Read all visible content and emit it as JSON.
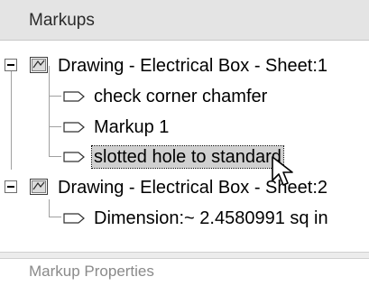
{
  "panel": {
    "title": "Markups",
    "footer_title": "Markup Properties"
  },
  "tree": {
    "sheets": [
      {
        "label": "Drawing - Electrical Box - Sheet:1",
        "expanded": true,
        "children": [
          {
            "label": "check corner chamfer",
            "selected": false
          },
          {
            "label": "Markup 1",
            "selected": false
          },
          {
            "label": "slotted hole to standard",
            "selected": true
          }
        ]
      },
      {
        "label": "Drawing - Electrical Box - Sheet:2",
        "expanded": true,
        "children": [
          {
            "label": "Dimension:~ 2.4580991 sq in",
            "selected": false
          }
        ]
      }
    ]
  },
  "icons": {
    "sheet": "drawing-sheet-icon",
    "markup": "markup-tag-icon",
    "expander": "collapse-minus-icon",
    "cursor": "mouse-pointer-icon"
  },
  "colors": {
    "header_bg": "#e4e4e4",
    "selection_bg": "#d0d0d0",
    "tree_lines": "#a0a0a0"
  }
}
